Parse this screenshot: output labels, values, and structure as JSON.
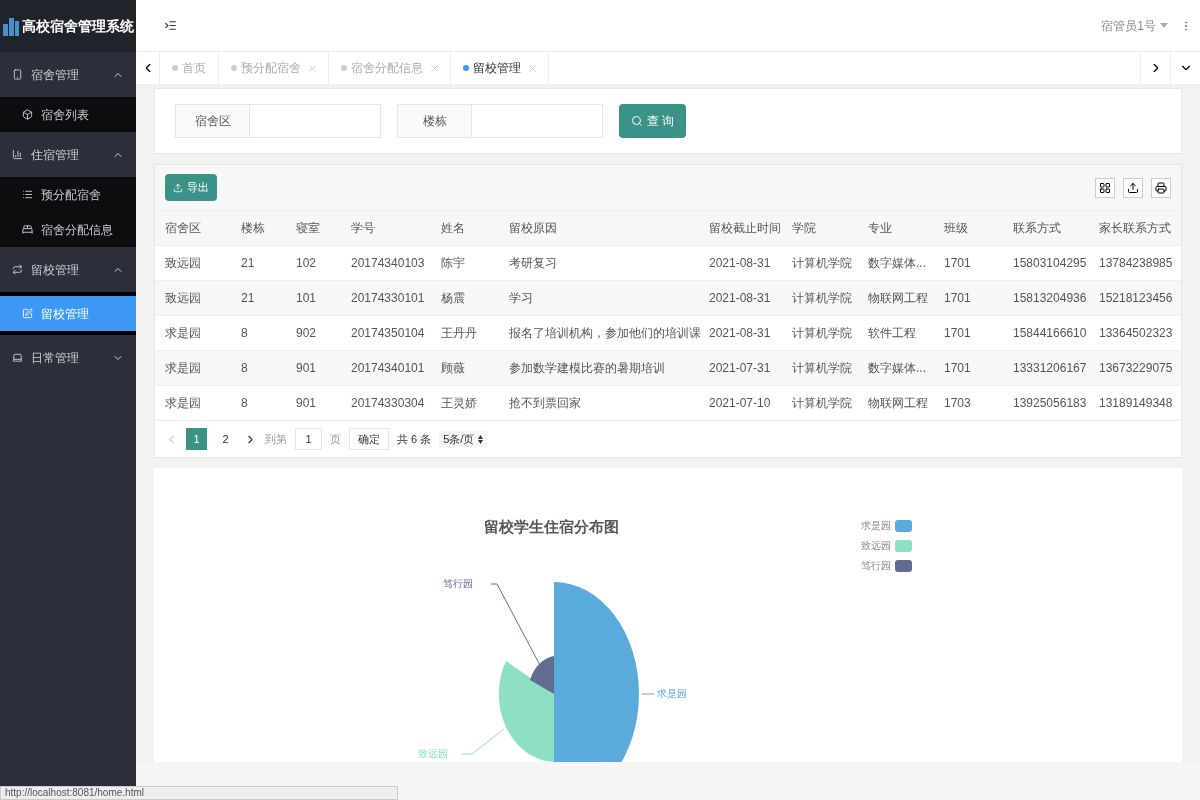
{
  "app_title": "高校宿舍管理系统",
  "user": {
    "name": "宿管员1号"
  },
  "sidebar": {
    "groups": [
      {
        "label": "宿舍管理",
        "expanded": true,
        "children": [
          {
            "label": "宿舍列表",
            "selected": false
          }
        ]
      },
      {
        "label": "住宿管理",
        "expanded": true,
        "children": [
          {
            "label": "预分配宿舍",
            "selected": false
          },
          {
            "label": "宿舍分配信息",
            "selected": false
          }
        ]
      },
      {
        "label": "留校管理",
        "expanded": true,
        "children": [
          {
            "label": "留校管理",
            "selected": true
          }
        ]
      },
      {
        "label": "日常管理",
        "expanded": false
      }
    ]
  },
  "tabs": [
    {
      "label": "首页",
      "selected": false,
      "closable": false
    },
    {
      "label": "预分配宿舍",
      "selected": false,
      "closable": true
    },
    {
      "label": "宿舍分配信息",
      "selected": false,
      "closable": true
    },
    {
      "label": "留校管理",
      "selected": true,
      "closable": true
    }
  ],
  "search": {
    "fields": [
      {
        "label": "宿舍区"
      },
      {
        "label": "楼栋"
      }
    ],
    "button": "查 询"
  },
  "table": {
    "export_button": "导出",
    "columns": [
      "宿舍区",
      "楼栋",
      "寝室",
      "学号",
      "姓名",
      "留校原因",
      "留校截止时间",
      "学院",
      "专业",
      "班级",
      "联系方式",
      "家长联系方式"
    ],
    "rows": [
      [
        "致远园",
        "21",
        "102",
        "20174340103",
        "陈宇",
        "考研复习",
        "2021-08-31",
        "计算机学院",
        "数字媒体...",
        "1701",
        "15803104295",
        "13784238985"
      ],
      [
        "致远园",
        "21",
        "101",
        "20174330101",
        "杨震",
        "学习",
        "2021-08-31",
        "计算机学院",
        "物联网工程",
        "1701",
        "15813204936",
        "15218123456"
      ],
      [
        "求是园",
        "8",
        "902",
        "20174350104",
        "王丹丹",
        "报名了培训机构，参加他们的培训课",
        "2021-08-31",
        "计算机学院",
        "软件工程",
        "1701",
        "15844166610",
        "13364502323"
      ],
      [
        "求是园",
        "8",
        "901",
        "20174340101",
        "顾薇",
        "参加数学建模比赛的暑期培训",
        "2021-07-31",
        "计算机学院",
        "数字媒体...",
        "1701",
        "13331206167",
        "13673229075"
      ],
      [
        "求是园",
        "8",
        "901",
        "20174330304",
        "王灵娇",
        "抢不到票回家",
        "2021-07-10",
        "计算机学院",
        "物联网工程",
        "1703",
        "13925056183",
        "13189149348"
      ]
    ]
  },
  "pagination": {
    "pages": [
      {
        "label": "1",
        "selected": true
      },
      {
        "label": "2",
        "selected": false
      }
    ],
    "goto_label": "到第",
    "page_value": "1",
    "page_unit": "页",
    "confirm": "确定",
    "total": "共 6 条",
    "page_size": "5条/页"
  },
  "chart": {
    "title": "留校学生住宿分布图",
    "legend": [
      {
        "label": "求是园",
        "color": "#5aaadb"
      },
      {
        "label": "致远园",
        "color": "#8de0c3"
      },
      {
        "label": "笃行园",
        "color": "#626c91"
      }
    ],
    "slice_labels": [
      "求是园",
      "致远园",
      "笃行园"
    ]
  },
  "status_url": "http://localhost:8081/home.html"
}
